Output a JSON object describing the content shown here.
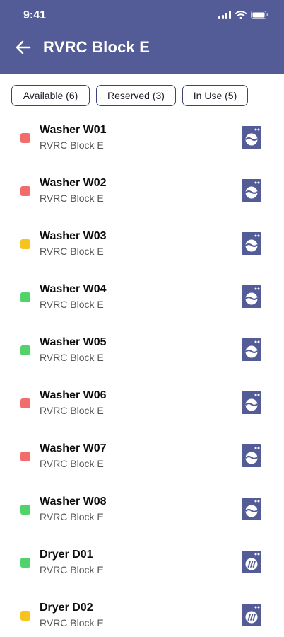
{
  "status": {
    "time": "9:41"
  },
  "header": {
    "title": "RVRC Block E"
  },
  "filters": [
    {
      "label": "Available (6)"
    },
    {
      "label": "Reserved (3)"
    },
    {
      "label": "In Use (5)"
    }
  ],
  "colors": {
    "header_bg": "#535c96",
    "icon_bg": "#535c96",
    "status_in_use": "#f26c6c",
    "status_reserved": "#f7c41f",
    "status_available": "#52d26a"
  },
  "machines": [
    {
      "name": "Washer W01",
      "location": "RVRC Block E",
      "status": "in_use",
      "icon": "washer-icon"
    },
    {
      "name": "Washer W02",
      "location": "RVRC Block E",
      "status": "in_use",
      "icon": "washer-icon"
    },
    {
      "name": "Washer W03",
      "location": "RVRC Block E",
      "status": "reserved",
      "icon": "washer-icon"
    },
    {
      "name": "Washer W04",
      "location": "RVRC Block E",
      "status": "available",
      "icon": "washer-icon"
    },
    {
      "name": "Washer W05",
      "location": "RVRC Block E",
      "status": "available",
      "icon": "washer-icon"
    },
    {
      "name": "Washer W06",
      "location": "RVRC Block E",
      "status": "in_use",
      "icon": "washer-icon"
    },
    {
      "name": "Washer W07",
      "location": "RVRC Block E",
      "status": "in_use",
      "icon": "washer-icon"
    },
    {
      "name": "Washer W08",
      "location": "RVRC Block E",
      "status": "available",
      "icon": "washer-icon"
    },
    {
      "name": "Dryer D01",
      "location": "RVRC Block E",
      "status": "available",
      "icon": "dryer-icon"
    },
    {
      "name": "Dryer D02",
      "location": "RVRC Block E",
      "status": "reserved",
      "icon": "dryer-icon"
    }
  ]
}
